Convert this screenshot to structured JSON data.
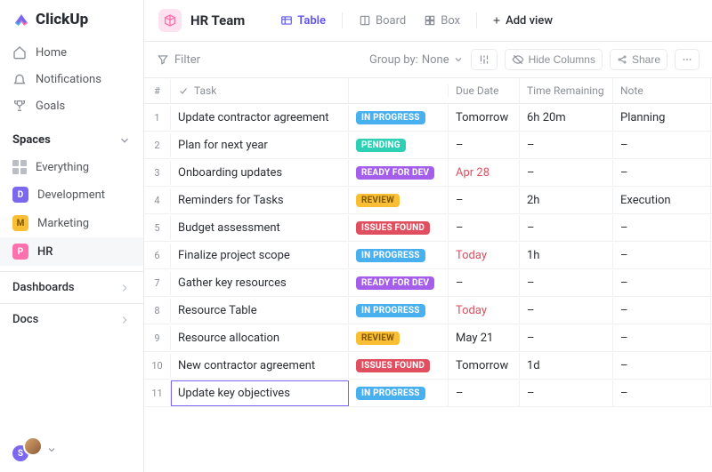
{
  "brand": "ClickUp",
  "nav": {
    "home": "Home",
    "notifications": "Notifications",
    "goals": "Goals"
  },
  "spaces": {
    "header": "Spaces",
    "everything": "Everything",
    "items": [
      {
        "letter": "D",
        "label": "Development",
        "color": "color-purple"
      },
      {
        "letter": "M",
        "label": "Marketing",
        "color": "color-yellow"
      },
      {
        "letter": "P",
        "label": "HR",
        "color": "color-pink"
      }
    ]
  },
  "sections": {
    "dashboards": "Dashboards",
    "docs": "Docs"
  },
  "users": [
    {
      "initial": "S",
      "cls": "bg-purple"
    },
    {
      "initial": "",
      "cls": "bg-photo"
    }
  ],
  "header": {
    "team": "HR Team"
  },
  "views": {
    "table": "Table",
    "board": "Board",
    "box": "Box",
    "add": "Add view"
  },
  "toolbar": {
    "filter": "Filter",
    "groupby_label": "Group by:",
    "groupby_value": "None",
    "hide_columns": "Hide Columns",
    "share": "Share"
  },
  "columns": {
    "num": "#",
    "task": "Task",
    "due": "Due Date",
    "time": "Time Remaining",
    "note": "Note"
  },
  "status_labels": {
    "inprogress": "IN PROGRESS",
    "pending": "PENDING",
    "ready": "READY FOR DEV",
    "review": "REVIEW",
    "issues": "ISSUES FOUND"
  },
  "rows": [
    {
      "n": "1",
      "task": "Update contractor agreement",
      "status": "inprogress",
      "due": "Tomorrow",
      "due_red": false,
      "time": "6h 20m",
      "note": "Planning"
    },
    {
      "n": "2",
      "task": "Plan for next year",
      "status": "pending",
      "due": "–",
      "due_red": false,
      "time": "–",
      "note": "–"
    },
    {
      "n": "3",
      "task": "Onboarding updates",
      "status": "ready",
      "due": "Apr 28",
      "due_red": true,
      "time": "–",
      "note": "–"
    },
    {
      "n": "4",
      "task": "Reminders for Tasks",
      "status": "review",
      "due": "–",
      "due_red": false,
      "time": "2h",
      "note": "Execution"
    },
    {
      "n": "5",
      "task": "Budget assessment",
      "status": "issues",
      "due": "–",
      "due_red": false,
      "time": "–",
      "note": "–"
    },
    {
      "n": "6",
      "task": "Finalize project scope",
      "status": "inprogress",
      "due": "Today",
      "due_red": true,
      "time": "1h",
      "note": "–"
    },
    {
      "n": "7",
      "task": "Gather key resources",
      "status": "ready",
      "due": "–",
      "due_red": false,
      "time": "–",
      "note": "–"
    },
    {
      "n": "8",
      "task": "Resource Table",
      "status": "inprogress",
      "due": "Today",
      "due_red": true,
      "time": "–",
      "note": "–"
    },
    {
      "n": "9",
      "task": "Resource allocation",
      "status": "review",
      "due": "May 21",
      "due_red": false,
      "time": "–",
      "note": "–"
    },
    {
      "n": "10",
      "task": "New contractor agreement",
      "status": "issues",
      "due": "Tomorrow",
      "due_red": false,
      "time": "1d",
      "note": "–"
    },
    {
      "n": "11",
      "task": "Update key objectives",
      "status": "inprogress",
      "due": "–",
      "due_red": false,
      "time": "–",
      "note": "–",
      "editing": true
    }
  ]
}
